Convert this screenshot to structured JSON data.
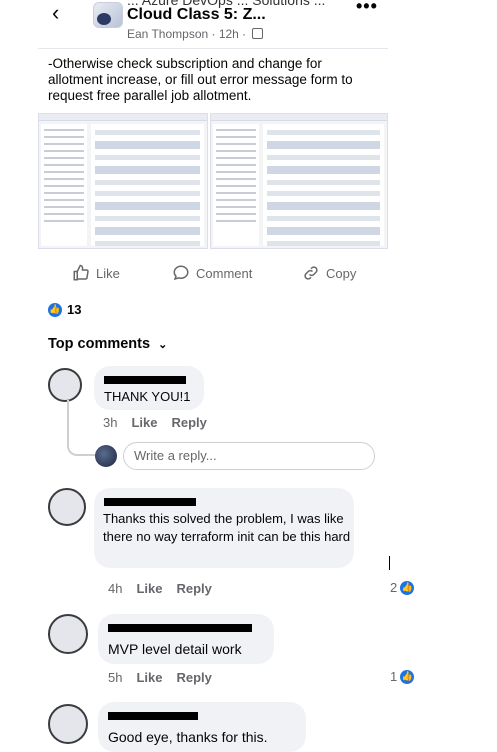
{
  "header": {
    "cut_text": "... Azure DevOps ... Solutions ...",
    "group_title": "Cloud Class 5: Z...",
    "author_line": "Ean Thompson · 12h ·",
    "back_icon": "back-arrow-icon",
    "more_icon": "more-options-icon"
  },
  "post": {
    "text": "-Otherwise check subscription and change for allotment increase, or fill out error message form to request free parallel job allotment."
  },
  "actions": {
    "like": "Like",
    "comment": "Comment",
    "copy": "Copy"
  },
  "reactions": {
    "count": "13"
  },
  "comments_header": "Top comments",
  "comments": [
    {
      "text": "THANK YOU!1",
      "time": "3h",
      "like": "Like",
      "reply": "Reply"
    },
    {
      "text": "Thanks this solved the problem, I was like there no way terraform init can be this hard",
      "time": "4h",
      "like": "Like",
      "reply": "Reply",
      "reactions": "2"
    },
    {
      "text": "MVP level detail work",
      "time": "5h",
      "like": "Like",
      "reply": "Reply",
      "reactions": "1"
    },
    {
      "text": "Good eye, thanks for this."
    }
  ],
  "reply_box": {
    "placeholder": "Write a reply..."
  },
  "colors": {
    "accent": "#1b74e4",
    "bubble": "#f0f2f5",
    "muted": "#65676b"
  }
}
